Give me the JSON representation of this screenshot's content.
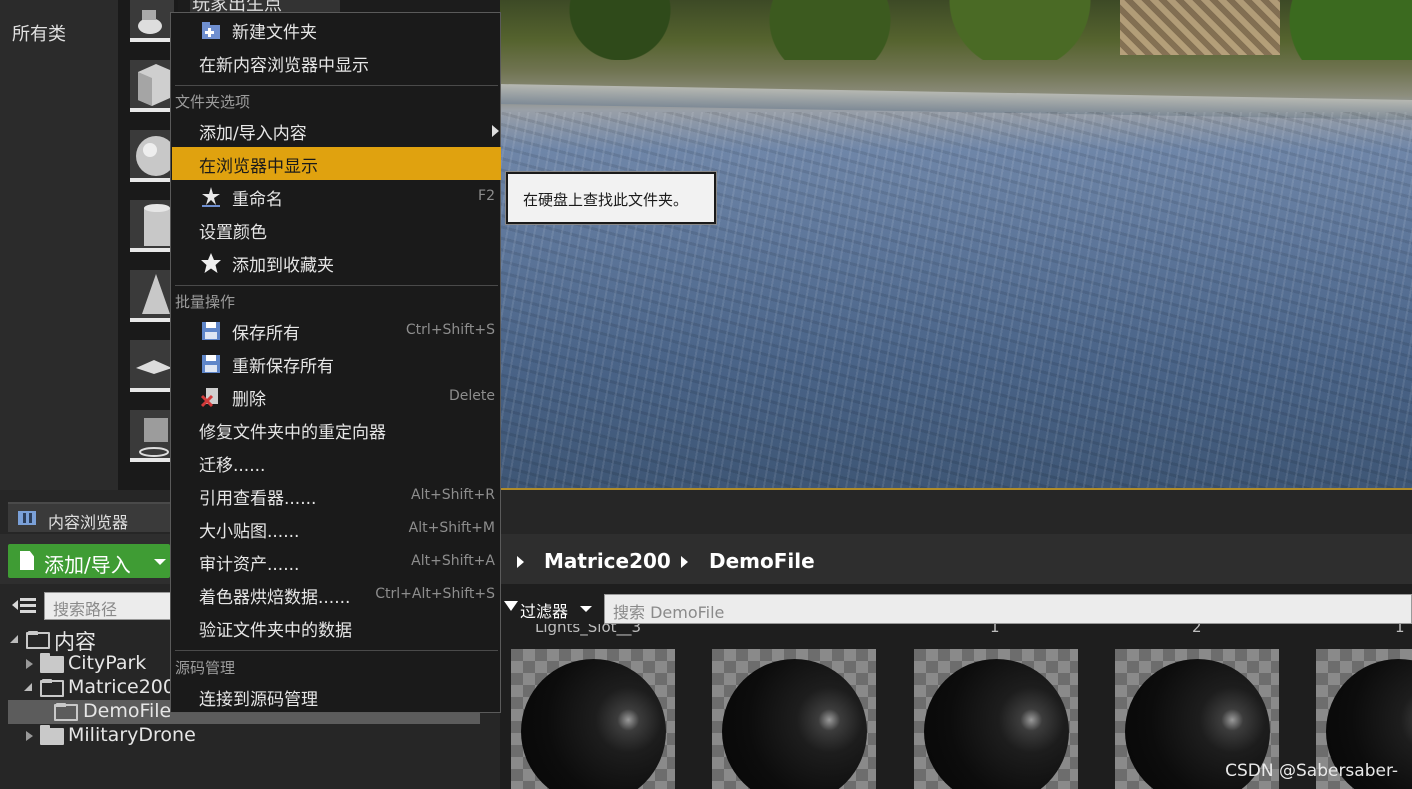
{
  "place_panel": {
    "category_label": "所有类",
    "header_fragment": "玩家出生点"
  },
  "context_menu": {
    "items_top": [
      {
        "label": "新建文件夹",
        "icon": "new-folder-icon"
      },
      {
        "label": "在新内容浏览器中显示"
      }
    ],
    "section_folder_options": "文件夹选项",
    "items_folder": [
      {
        "label": "添加/导入内容",
        "submenu": true
      },
      {
        "label": "在浏览器中显示",
        "highlighted": true
      },
      {
        "label": "重命名",
        "shortcut": "F2",
        "icon": "rename-icon"
      },
      {
        "label": "设置颜色"
      },
      {
        "label": "添加到收藏夹",
        "icon": "star-icon"
      }
    ],
    "section_bulk": "批量操作",
    "items_bulk": [
      {
        "label": "保存所有",
        "shortcut": "Ctrl+Shift+S",
        "icon": "save-icon"
      },
      {
        "label": "重新保存所有",
        "icon": "save-icon"
      },
      {
        "label": "删除",
        "shortcut": "Delete",
        "icon": "delete-icon"
      },
      {
        "label": "修复文件夹中的重定向器"
      },
      {
        "label": "迁移......"
      },
      {
        "label": "引用查看器......",
        "shortcut": "Alt+Shift+R"
      },
      {
        "label": "大小贴图......",
        "shortcut": "Alt+Shift+M"
      },
      {
        "label": "审计资产......",
        "shortcut": "Alt+Shift+A"
      },
      {
        "label": "着色器烘焙数据......",
        "shortcut": "Ctrl+Alt+Shift+S"
      },
      {
        "label": "验证文件夹中的数据"
      }
    ],
    "section_source": "源码管理",
    "items_source": [
      {
        "label": "连接到源码管理"
      }
    ]
  },
  "tooltip": "在硬盘上查找此文件夹。",
  "content_browser": {
    "tab_label": "内容浏览器",
    "add_import_label": "添加/导入",
    "breadcrumbs": [
      "Matrice200",
      "DemoFile"
    ],
    "path_search_placeholder": "搜索路径",
    "filter_label": "过滤器",
    "asset_search_placeholder": "搜索 DemoFile",
    "tree": [
      {
        "label": "内容",
        "expanded": true
      },
      {
        "label": "CityPark",
        "expanded": false
      },
      {
        "label": "Matrice200",
        "expanded": true
      },
      {
        "label": "DemoFile",
        "selected": true
      },
      {
        "label": "MilitaryDrone",
        "expanded": false
      }
    ],
    "asset_name_fragments": [
      "Lights_Slot__3",
      "1",
      "2",
      "1"
    ],
    "asset_count_visible": 5
  },
  "watermark": "CSDN @Sabersaber-",
  "colors": {
    "highlight": "#e0a20f",
    "add_button": "#3f9c34",
    "menu_bg": "#1a1a1a"
  }
}
